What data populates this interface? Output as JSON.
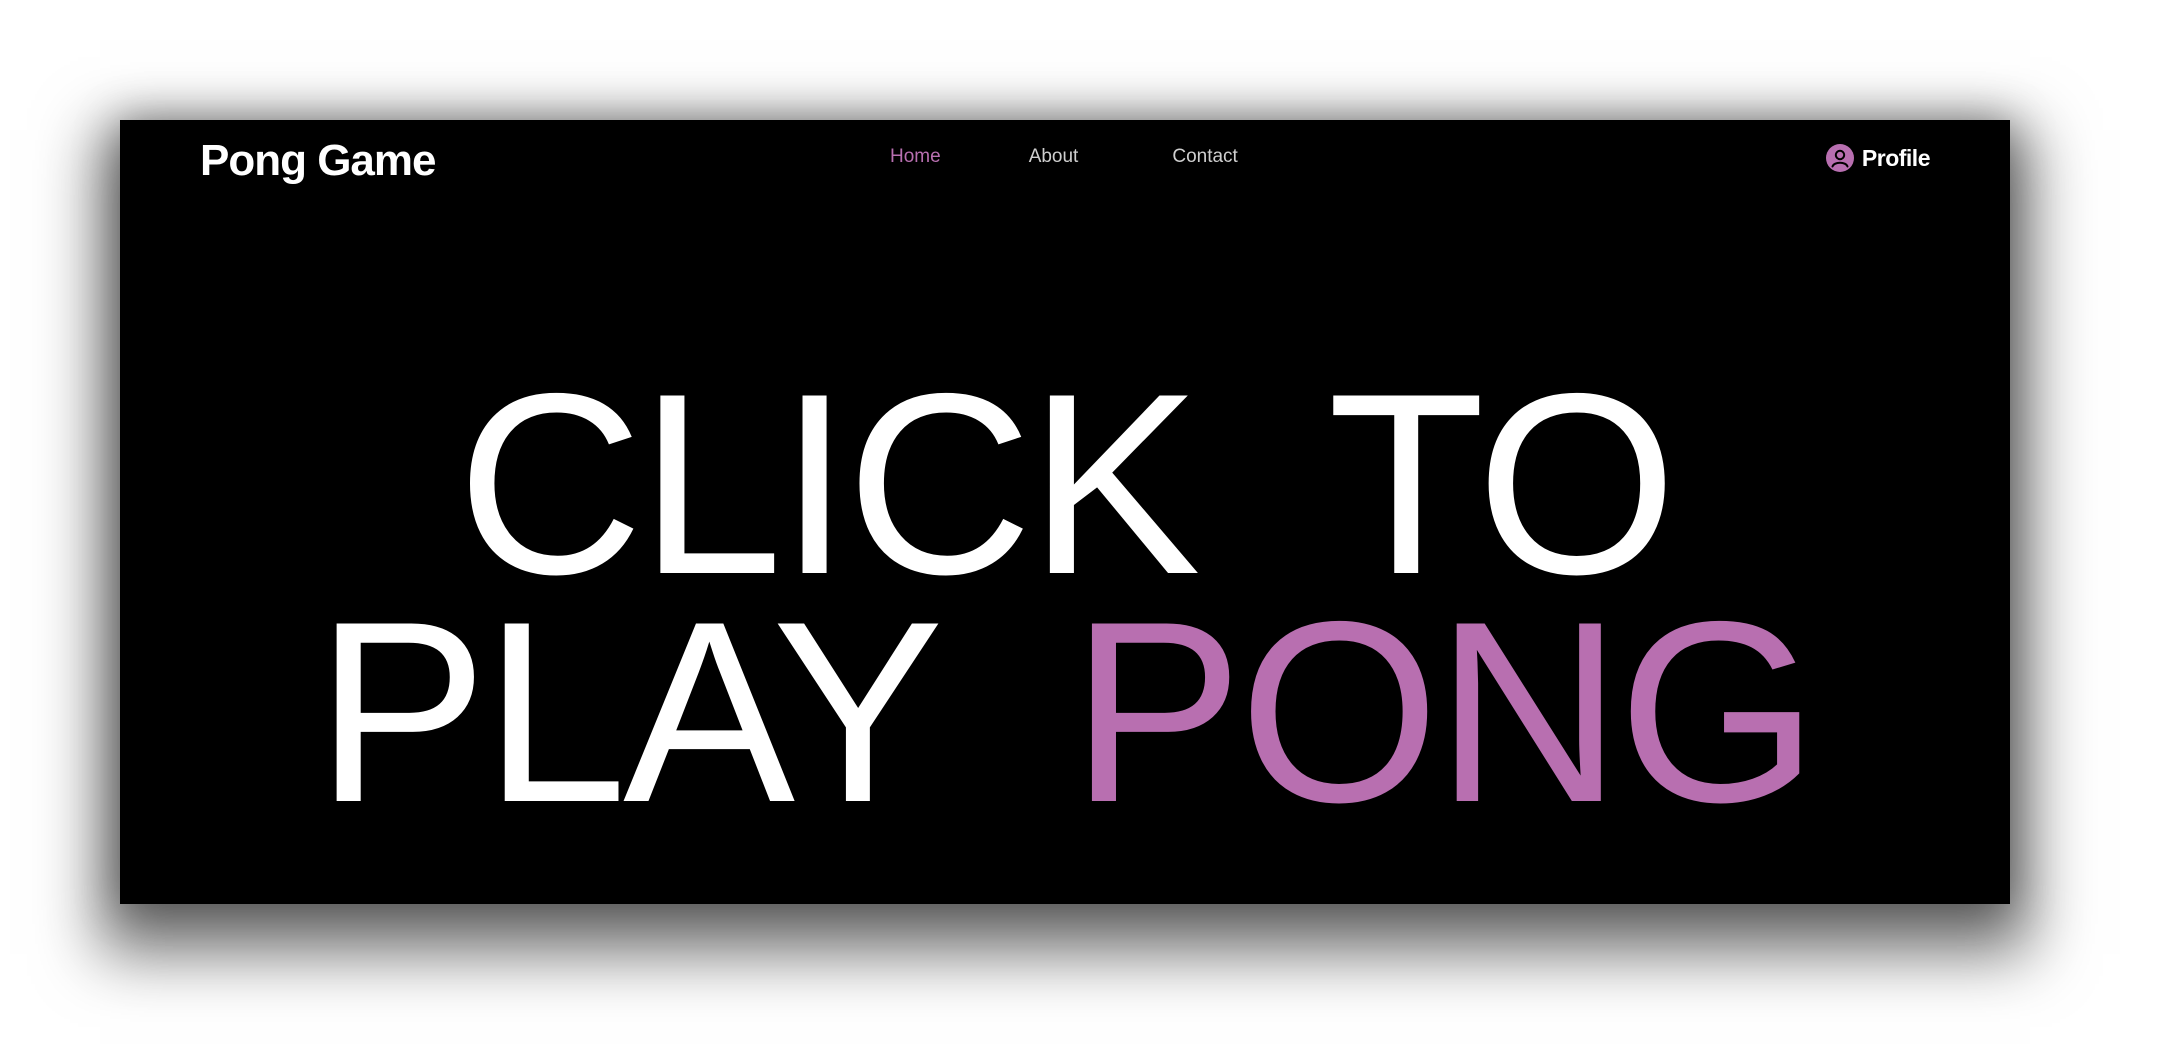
{
  "brand": {
    "title": "Pong Game"
  },
  "nav": {
    "links": [
      {
        "label": "Home",
        "active": true
      },
      {
        "label": "About",
        "active": false
      },
      {
        "label": "Contact",
        "active": false
      }
    ]
  },
  "profile": {
    "label": "Profile",
    "icon": "user-circle-icon"
  },
  "hero": {
    "line1": "CLICK  TO",
    "line2_prefix": "PLAY  ",
    "line2_accent": "PONG"
  },
  "colors": {
    "background": "#000000",
    "text": "#ffffff",
    "accent": "#b86fb0",
    "nav_link": "#cfcfcf"
  }
}
